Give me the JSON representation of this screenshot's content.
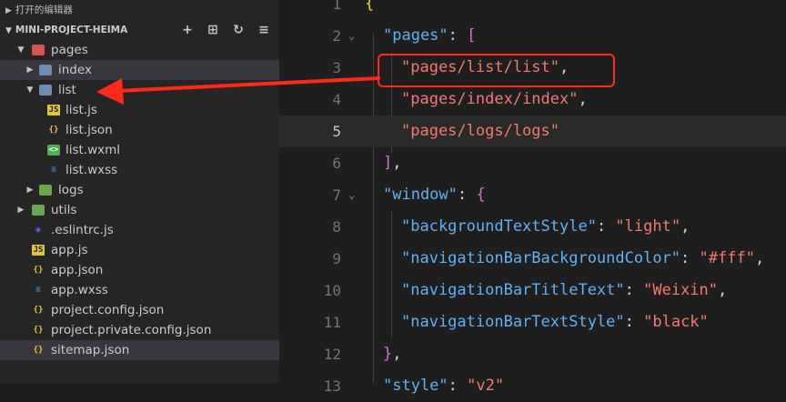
{
  "sidebar": {
    "open_editors_label": "打开的编辑器",
    "project_label": "MINI-PROJECT-HEIMA",
    "actions": [
      "new-file-icon",
      "new-folder-icon",
      "refresh-icon",
      "collapse-icon"
    ],
    "tree": [
      {
        "label": "pages",
        "icon": "folder-open-icon"
      },
      {
        "label": "index",
        "icon": "folder-icon"
      },
      {
        "label": "list",
        "icon": "folder-open-icon"
      },
      {
        "label": "list.js",
        "icon": "js-file-icon"
      },
      {
        "label": "list.json",
        "icon": "json-file-icon"
      },
      {
        "label": "list.wxml",
        "icon": "wxml-file-icon"
      },
      {
        "label": "list.wxss",
        "icon": "css-file-icon"
      },
      {
        "label": "logs",
        "icon": "folder-icon"
      },
      {
        "label": "utils",
        "icon": "folder-icon"
      },
      {
        "label": ".eslintrc.js",
        "icon": "eslint-file-icon"
      },
      {
        "label": "app.js",
        "icon": "js-file-icon"
      },
      {
        "label": "app.json",
        "icon": "json-file-icon"
      },
      {
        "label": "app.wxss",
        "icon": "css-file-icon"
      },
      {
        "label": "project.config.json",
        "icon": "json-file-icon"
      },
      {
        "label": "project.private.config.json",
        "icon": "json-file-icon"
      },
      {
        "label": "sitemap.json",
        "icon": "json-file-icon"
      }
    ]
  },
  "editor": {
    "lines": [
      {
        "n": "1",
        "t": [
          "{"
        ]
      },
      {
        "n": "2",
        "t": [
          "\"pages\"",
          ": ",
          "["
        ]
      },
      {
        "n": "3",
        "t": [
          "\"pages/list/list\"",
          ","
        ]
      },
      {
        "n": "4",
        "t": [
          "\"pages/index/index\"",
          ","
        ]
      },
      {
        "n": "5",
        "t": [
          "\"pages/logs/logs\""
        ]
      },
      {
        "n": "6",
        "t": [
          "]",
          ","
        ]
      },
      {
        "n": "7",
        "t": [
          "\"window\"",
          ": ",
          "{"
        ]
      },
      {
        "n": "8",
        "t": [
          "\"backgroundTextStyle\"",
          ": ",
          "\"light\"",
          ","
        ]
      },
      {
        "n": "9",
        "t": [
          "\"navigationBarBackgroundColor\"",
          ": ",
          "\"#fff\"",
          ","
        ]
      },
      {
        "n": "10",
        "t": [
          "\"navigationBarTitleText\"",
          ": ",
          "\"Weixin\"",
          ","
        ]
      },
      {
        "n": "11",
        "t": [
          "\"navigationBarTextStyle\"",
          ": ",
          "\"black\""
        ]
      },
      {
        "n": "12",
        "t": [
          "}",
          ","
        ]
      },
      {
        "n": "13",
        "t": [
          "\"style\"",
          ": ",
          "\"v2\""
        ]
      }
    ]
  },
  "colors": {
    "annotation": "#ff2a1a",
    "key": "#62b1f6",
    "string": "#f07b6e"
  }
}
